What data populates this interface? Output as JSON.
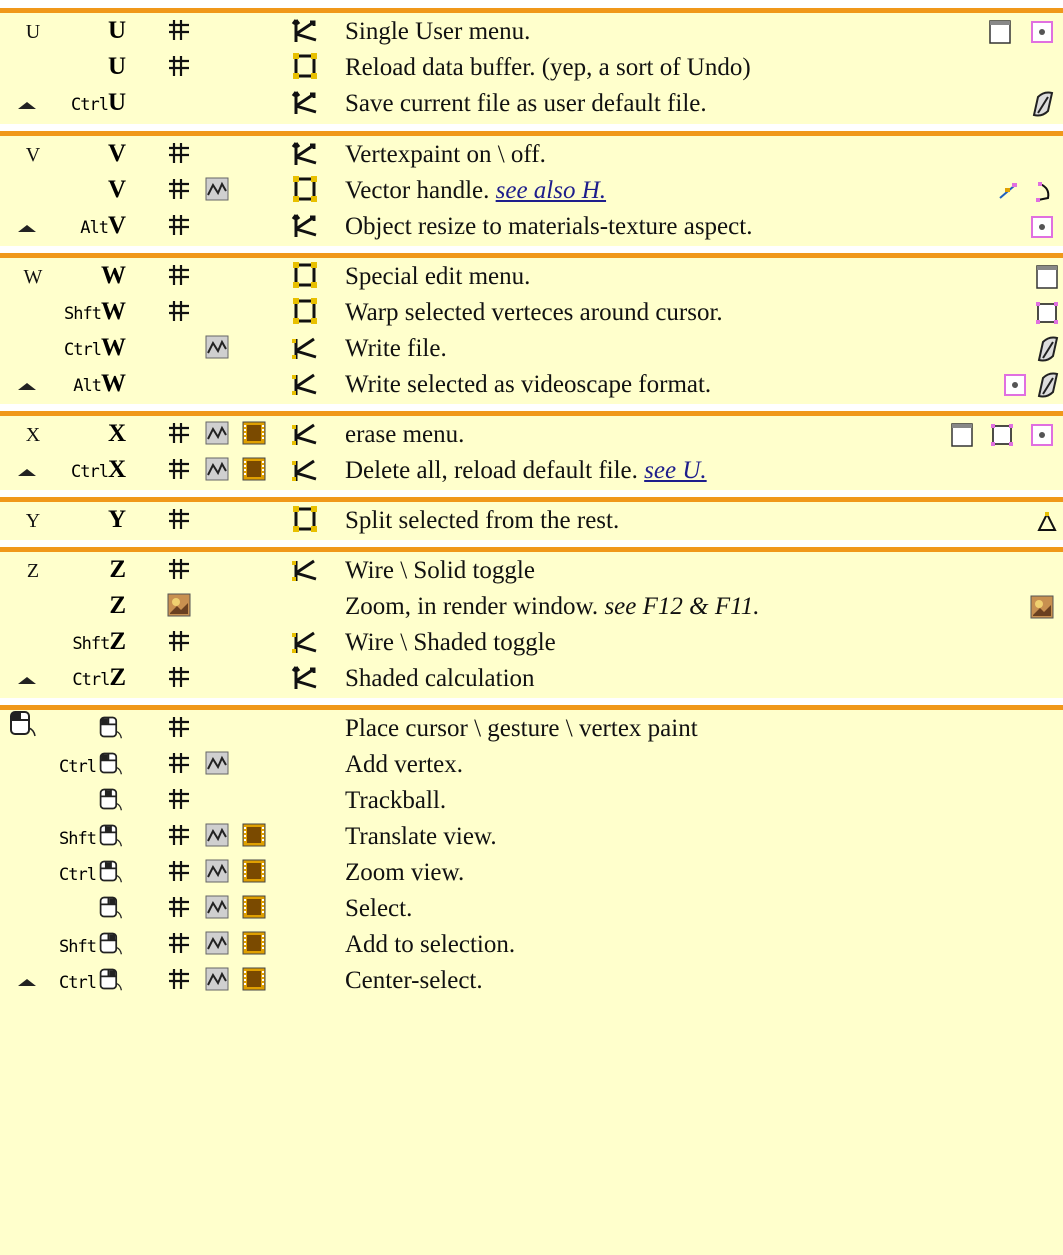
{
  "sections": [
    {
      "letter": "U",
      "rows": [
        {
          "mod": "",
          "key": "U",
          "desc": "Single User menu."
        },
        {
          "mod": "",
          "key": "U",
          "desc": "Reload data buffer. (yep, a sort of Undo)"
        },
        {
          "mod": "Ctrl",
          "key": "U",
          "desc": "Save current file as user default file."
        }
      ]
    },
    {
      "letter": "V",
      "rows": [
        {
          "mod": "",
          "key": "V",
          "desc": "Vertexpaint on \\ off."
        },
        {
          "mod": "",
          "key": "V",
          "desc": "Vector handle.",
          "link": "see also H."
        },
        {
          "mod": "Alt",
          "key": "V",
          "desc": "Object resize to materials-texture aspect."
        }
      ]
    },
    {
      "letter": "W",
      "rows": [
        {
          "mod": "",
          "key": "W",
          "desc": "Special edit menu."
        },
        {
          "mod": "Shft",
          "key": "W",
          "desc": "Warp selected verteces around cursor."
        },
        {
          "mod": "Ctrl",
          "key": "W",
          "desc": "Write file."
        },
        {
          "mod": "Alt",
          "key": "W",
          "desc": "Write selected as videoscape format."
        }
      ]
    },
    {
      "letter": "X",
      "rows": [
        {
          "mod": "",
          "key": "X",
          "desc": "erase menu."
        },
        {
          "mod": "Ctrl",
          "key": "X",
          "desc": "Delete all, reload default file.",
          "link": "see U."
        }
      ]
    },
    {
      "letter": "Y",
      "rows": [
        {
          "mod": "",
          "key": "Y",
          "desc": "Split selected from the rest."
        }
      ]
    },
    {
      "letter": "Z",
      "rows": [
        {
          "mod": "",
          "key": "Z",
          "desc": "Wire \\ Solid toggle"
        },
        {
          "mod": "",
          "key": "Z",
          "desc": "Zoom, in render window.",
          "note": "see F12 & F11."
        },
        {
          "mod": "Shft",
          "key": "Z",
          "desc": "Wire \\ Shaded toggle"
        },
        {
          "mod": "Ctrl",
          "key": "Z",
          "desc": "Shaded calculation"
        }
      ]
    },
    {
      "letter": "",
      "rows": [
        {
          "mod": "",
          "key": "",
          "desc": "Place cursor \\ gesture \\ vertex paint"
        },
        {
          "mod": "Ctrl",
          "key": "",
          "desc": "Add vertex."
        },
        {
          "mod": "",
          "key": "",
          "desc": "Trackball."
        },
        {
          "mod": "Shft",
          "key": "",
          "desc": "Translate view."
        },
        {
          "mod": "Ctrl",
          "key": "",
          "desc": "Zoom view."
        },
        {
          "mod": "",
          "key": "",
          "desc": "Select."
        },
        {
          "mod": "Shft",
          "key": "",
          "desc": "Add to selection."
        },
        {
          "mod": "Ctrl",
          "key": "",
          "desc": "Center-select."
        }
      ]
    }
  ],
  "colors": {
    "section_bg": "#ffffcc",
    "divider": "#f0981a",
    "link": "#1e1e8c"
  }
}
